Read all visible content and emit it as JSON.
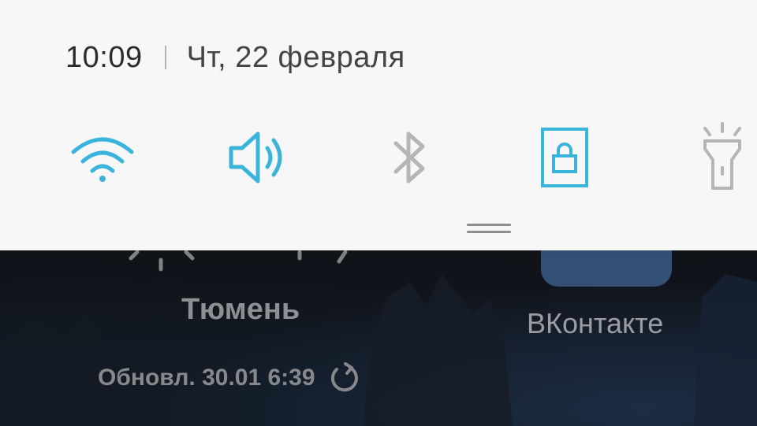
{
  "status": {
    "time": "10:09",
    "date": "Чт, 22 февраля"
  },
  "quick_settings": [
    {
      "id": "wifi",
      "icon": "wifi-icon",
      "active": true
    },
    {
      "id": "sound",
      "icon": "volume-icon",
      "active": true
    },
    {
      "id": "bluetooth",
      "icon": "bluetooth-icon",
      "active": false
    },
    {
      "id": "rotation_lock",
      "icon": "screen-lock-icon",
      "active": true
    },
    {
      "id": "flashlight",
      "icon": "flashlight-icon",
      "active": false
    }
  ],
  "colors": {
    "active": "#3bb4dc",
    "inactive": "#b5b5b5",
    "shade_bg": "#f7f7f7"
  },
  "home": {
    "weather": {
      "city": "Тюмень",
      "updated": "Обновл. 30.01 6:39"
    },
    "app": {
      "label": "ВКонтакте"
    }
  }
}
